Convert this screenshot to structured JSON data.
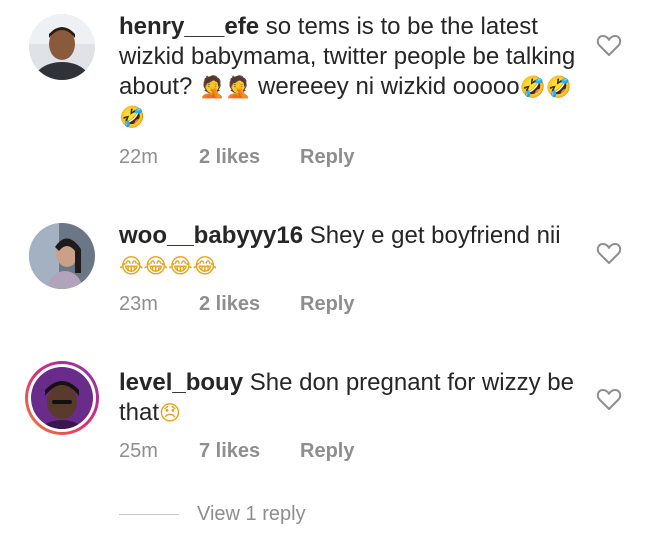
{
  "comments": [
    {
      "username": "henry___efe",
      "text": " so tems is to be the latest wizkid babymama, twitter people be talking about?",
      "emoji_a": "🤦",
      "text2": " wereeey ni wizkid ooooo",
      "emoji_b": "🤣🤣🤣",
      "time": "22m",
      "likes": "2 likes",
      "reply": "Reply",
      "avatar_icon": "avatar-photo"
    },
    {
      "username": "woo__babyyy16",
      "text": " Shey e get boyfriend nii",
      "emoji_a": "😂😂😂😂",
      "time": "23m",
      "likes": "2 likes",
      "reply": "Reply",
      "avatar_icon": "avatar-photo"
    },
    {
      "username": "level_bouy",
      "text": " She don pregnant for wizzy be that",
      "emoji_a": "😞",
      "time": "25m",
      "likes": "7 likes",
      "reply": "Reply",
      "avatar_icon": "avatar-photo-story-ring"
    }
  ],
  "view_replies": "View 1 reply",
  "icons": {
    "like": "heart-outline-icon"
  },
  "colors": {
    "text": "#262626",
    "meta": "#8e8e8e",
    "story_ring_start": "#f58529",
    "story_ring_end": "#dd2a7b"
  }
}
